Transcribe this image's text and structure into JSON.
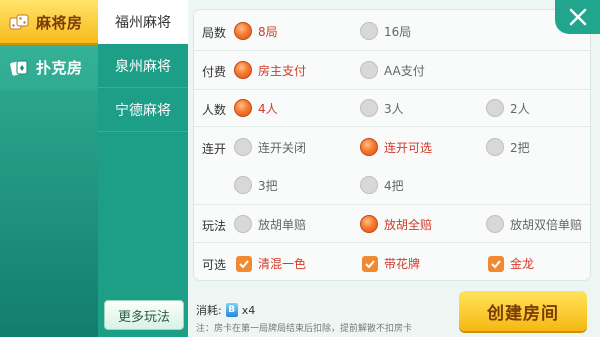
{
  "categories": [
    {
      "label": "麻将房",
      "icon": "dice-icon",
      "active": true
    },
    {
      "label": "扑克房",
      "icon": "cards-icon",
      "active": false
    }
  ],
  "subtypes": [
    {
      "label": "福州麻将",
      "active": true
    },
    {
      "label": "泉州麻将",
      "active": false
    },
    {
      "label": "宁德麻将",
      "active": false
    }
  ],
  "more_button": "更多玩法",
  "rows": {
    "rounds": {
      "label": "局数",
      "options": [
        "8局",
        "16局"
      ],
      "selected": 0
    },
    "payment": {
      "label": "付费",
      "options": [
        "房主支付",
        "AA支付"
      ],
      "selected": 0
    },
    "players": {
      "label": "人数",
      "options": [
        "4人",
        "3人",
        "2人"
      ],
      "selected": 0
    },
    "streak": {
      "label": "连开",
      "options": [
        "连开关闭",
        "连开可选",
        "2把",
        "3把",
        "4把"
      ],
      "selected": 1
    },
    "mode": {
      "label": "玩法",
      "options": [
        "放胡单赔",
        "放胡全赔",
        "放胡双倍单赔"
      ],
      "selected": 1
    },
    "extras": {
      "label": "可选",
      "options": [
        "清混一色",
        "带花牌",
        "金龙"
      ],
      "checked": [
        true,
        true,
        true
      ]
    }
  },
  "cost": {
    "label": "消耗:",
    "card": "B",
    "amount": "x4"
  },
  "note": "注：房卡在第一局牌局结束后扣除，提前解散不扣房卡",
  "create_button": "创建房间",
  "colors": {
    "accent": "#1d9e86",
    "selected": "#d13b2a",
    "button": "#f6b812"
  }
}
